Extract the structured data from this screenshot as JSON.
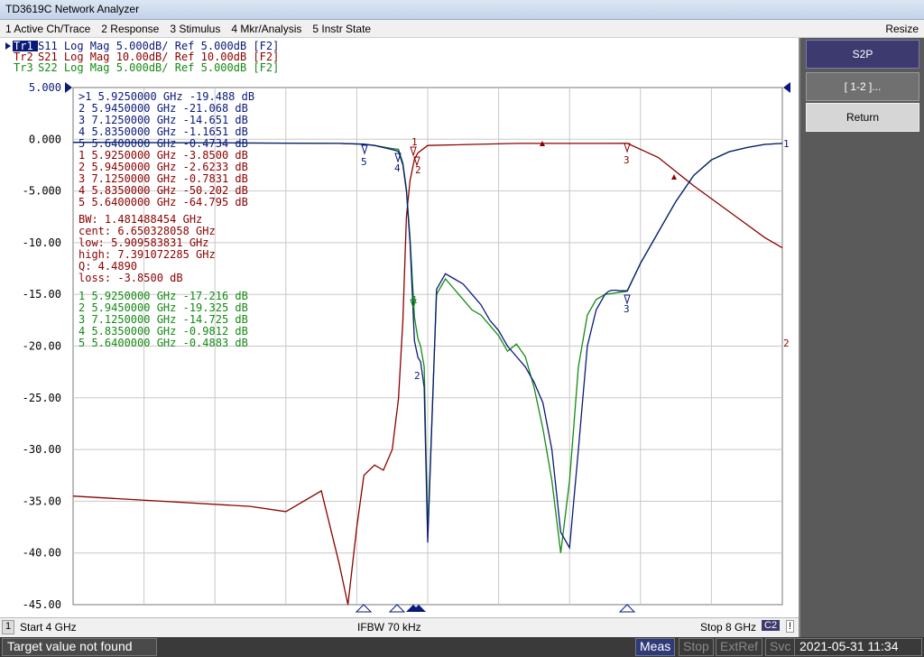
{
  "window": {
    "title": "TD3619C Network Analyzer"
  },
  "menu": [
    {
      "label": "1 Active Ch/Trace"
    },
    {
      "label": "2 Response"
    },
    {
      "label": "3 Stimulus"
    },
    {
      "label": "4 Mkr/Analysis"
    },
    {
      "label": "5 Instr State"
    }
  ],
  "resize_label": "Resize",
  "traces": [
    {
      "tag": "Tr1",
      "text": " S11 Log Mag 5.000dB/ Ref 5.000dB [F2]",
      "color": "#0a1a78"
    },
    {
      "tag": "Tr2",
      "text": " S21 Log Mag 10.00dB/ Ref 10.00dB [F2]",
      "color": "#8b0000"
    },
    {
      "tag": "Tr3",
      "text": " S22 Log Mag 5.000dB/ Ref 5.000dB [F2]",
      "color": "#138a13"
    }
  ],
  "y_ticks": [
    "5.000",
    "0.000",
    "-5.000",
    "-10.00",
    "-15.00",
    "-20.00",
    "-25.00",
    "-30.00",
    "-35.00",
    "-40.00",
    "-45.00"
  ],
  "marker_table_s11": [
    ">1  5.9250000 GHz -19.488 dB",
    " 2  5.9450000 GHz -21.068 dB",
    " 3  7.1250000 GHz -14.651 dB",
    " 4  5.8350000 GHz -1.1651 dB",
    " 5  5.6400000 GHz -0.4734 dB"
  ],
  "marker_table_s21": [
    " 1  5.9250000 GHz -3.8500 dB",
    " 2  5.9450000 GHz -2.6233 dB",
    " 3  7.1250000 GHz -0.7831 dB",
    " 4  5.8350000 GHz -50.202 dB",
    " 5  5.6400000 GHz -64.795 dB"
  ],
  "bw_stats": [
    "  BW:  1.481488454 GHz",
    "cent:  6.650328058 GHz",
    " low:  5.909583831 GHz",
    "high:  7.391072285 GHz",
    "   Q:  4.4890",
    "loss: -3.8500 dB"
  ],
  "marker_table_s22": [
    " 1  5.9250000 GHz -17.216 dB",
    " 2  5.9450000 GHz -19.325 dB",
    " 3  7.1250000 GHz -14.725 dB",
    " 4  5.8350000 GHz -0.9812 dB",
    " 5  5.6400000 GHz -0.4883 dB"
  ],
  "softkeys": {
    "title": "S2P",
    "sub": "[ 1-2 ]...",
    "return": "Return"
  },
  "status": {
    "channel": "1",
    "start": "Start 4 GHz",
    "ifbw": "IFBW 70 kHz",
    "stop": "Stop 8 GHz",
    "c2": "C2",
    "bang": "!"
  },
  "bottom": {
    "message": "Target value not found",
    "meas": "Meas",
    "stop": "Stop",
    "extref": "ExtRef",
    "svc": "Svc",
    "datetime": "2021-05-31 11:34"
  },
  "trace_end_labels": {
    "s11": "1",
    "s21": "2"
  },
  "marker_labels": {
    "s11_4": "4",
    "s11_5": "5",
    "s21_1": "1",
    "s21_2": "2",
    "s21_3": "3",
    "s11_3": "3",
    "s22_1": "1",
    "s22_2": "2"
  },
  "chart_data": {
    "type": "line",
    "x_unit": "GHz",
    "xlim": [
      4,
      8
    ],
    "series": [
      {
        "name": "S11",
        "scale_db_per_div": 5,
        "ref_db": 5,
        "x": [
          4.0,
          5.5,
          5.64,
          5.7,
          5.75,
          5.8,
          5.835,
          5.86,
          5.88,
          5.9,
          5.925,
          5.945,
          5.96,
          5.98,
          6.0,
          6.05,
          6.1,
          6.15,
          6.2,
          6.25,
          6.3,
          6.35,
          6.4,
          6.45,
          6.5,
          6.55,
          6.6,
          6.65,
          6.7,
          6.75,
          6.8,
          6.85,
          6.9,
          6.95,
          7.0,
          7.02,
          7.04,
          7.06,
          7.08,
          7.125,
          7.2,
          7.3,
          7.4,
          7.5,
          7.6,
          7.7,
          7.8,
          7.9,
          8.0
        ],
        "y": [
          -0.3,
          -0.4,
          -0.47,
          -0.6,
          -0.8,
          -1.0,
          -1.17,
          -2.5,
          -5.0,
          -10.0,
          -19.5,
          -21.1,
          -21.5,
          -24.0,
          -39.0,
          -14.5,
          -13.0,
          -13.5,
          -14.0,
          -15.0,
          -16.0,
          -17.5,
          -18.5,
          -20.0,
          -21.0,
          -22.0,
          -23.5,
          -25.5,
          -30.0,
          -38.0,
          -39.5,
          -30.0,
          -20.0,
          -16.5,
          -15.0,
          -14.7,
          -14.6,
          -14.6,
          -14.65,
          -14.65,
          -12.0,
          -9.0,
          -6.0,
          -3.5,
          -2.0,
          -1.2,
          -0.8,
          -0.5,
          -0.4
        ]
      },
      {
        "name": "S21",
        "scale_db_per_div": 10,
        "ref_db": 10,
        "x": [
          4.0,
          4.5,
          5.0,
          5.2,
          5.4,
          5.5,
          5.55,
          5.6,
          5.64,
          5.7,
          5.75,
          5.8,
          5.835,
          5.86,
          5.88,
          5.9,
          5.925,
          5.945,
          6.0,
          6.5,
          7.0,
          7.125,
          7.3,
          7.5,
          7.7,
          7.9,
          8.0
        ],
        "y": [
          -69.0,
          -70.0,
          -71.0,
          -72.0,
          -68.0,
          -82.0,
          -99.0,
          -75.0,
          -65.0,
          -63.0,
          -64.0,
          -60.0,
          -50.2,
          -35.0,
          -15.0,
          -8.0,
          -3.85,
          -2.62,
          -1.2,
          -0.8,
          -0.8,
          -0.78,
          -3.5,
          -9.0,
          -14.0,
          -19.0,
          -21.0
        ]
      },
      {
        "name": "S22",
        "scale_db_per_div": 5,
        "ref_db": 5,
        "x": [
          4.0,
          5.5,
          5.64,
          5.7,
          5.75,
          5.8,
          5.835,
          5.86,
          5.88,
          5.9,
          5.925,
          5.945,
          5.96,
          5.98,
          6.0,
          6.05,
          6.1,
          6.15,
          6.2,
          6.25,
          6.3,
          6.35,
          6.4,
          6.45,
          6.5,
          6.55,
          6.6,
          6.65,
          6.7,
          6.75,
          6.8,
          6.85,
          6.9,
          6.95,
          7.0,
          7.125,
          7.2,
          7.3,
          7.4,
          7.5,
          7.6,
          7.7,
          7.8,
          7.9,
          8.0
        ],
        "y": [
          -0.3,
          -0.4,
          -0.49,
          -0.6,
          -0.75,
          -0.9,
          -0.98,
          -2.3,
          -4.8,
          -9.5,
          -17.2,
          -19.3,
          -20.0,
          -22.0,
          -38.0,
          -15.0,
          -13.5,
          -14.5,
          -15.5,
          -16.5,
          -17.0,
          -18.0,
          -19.0,
          -20.5,
          -19.8,
          -21.0,
          -24.0,
          -28.0,
          -33.0,
          -40.0,
          -33.0,
          -22.0,
          -17.0,
          -15.5,
          -15.0,
          -14.7,
          -12.0,
          -9.0,
          -6.0,
          -3.5,
          -2.0,
          -1.2,
          -0.8,
          -0.5,
          -0.4
        ]
      }
    ],
    "ylim": [
      -45,
      5
    ],
    "grid": true
  }
}
